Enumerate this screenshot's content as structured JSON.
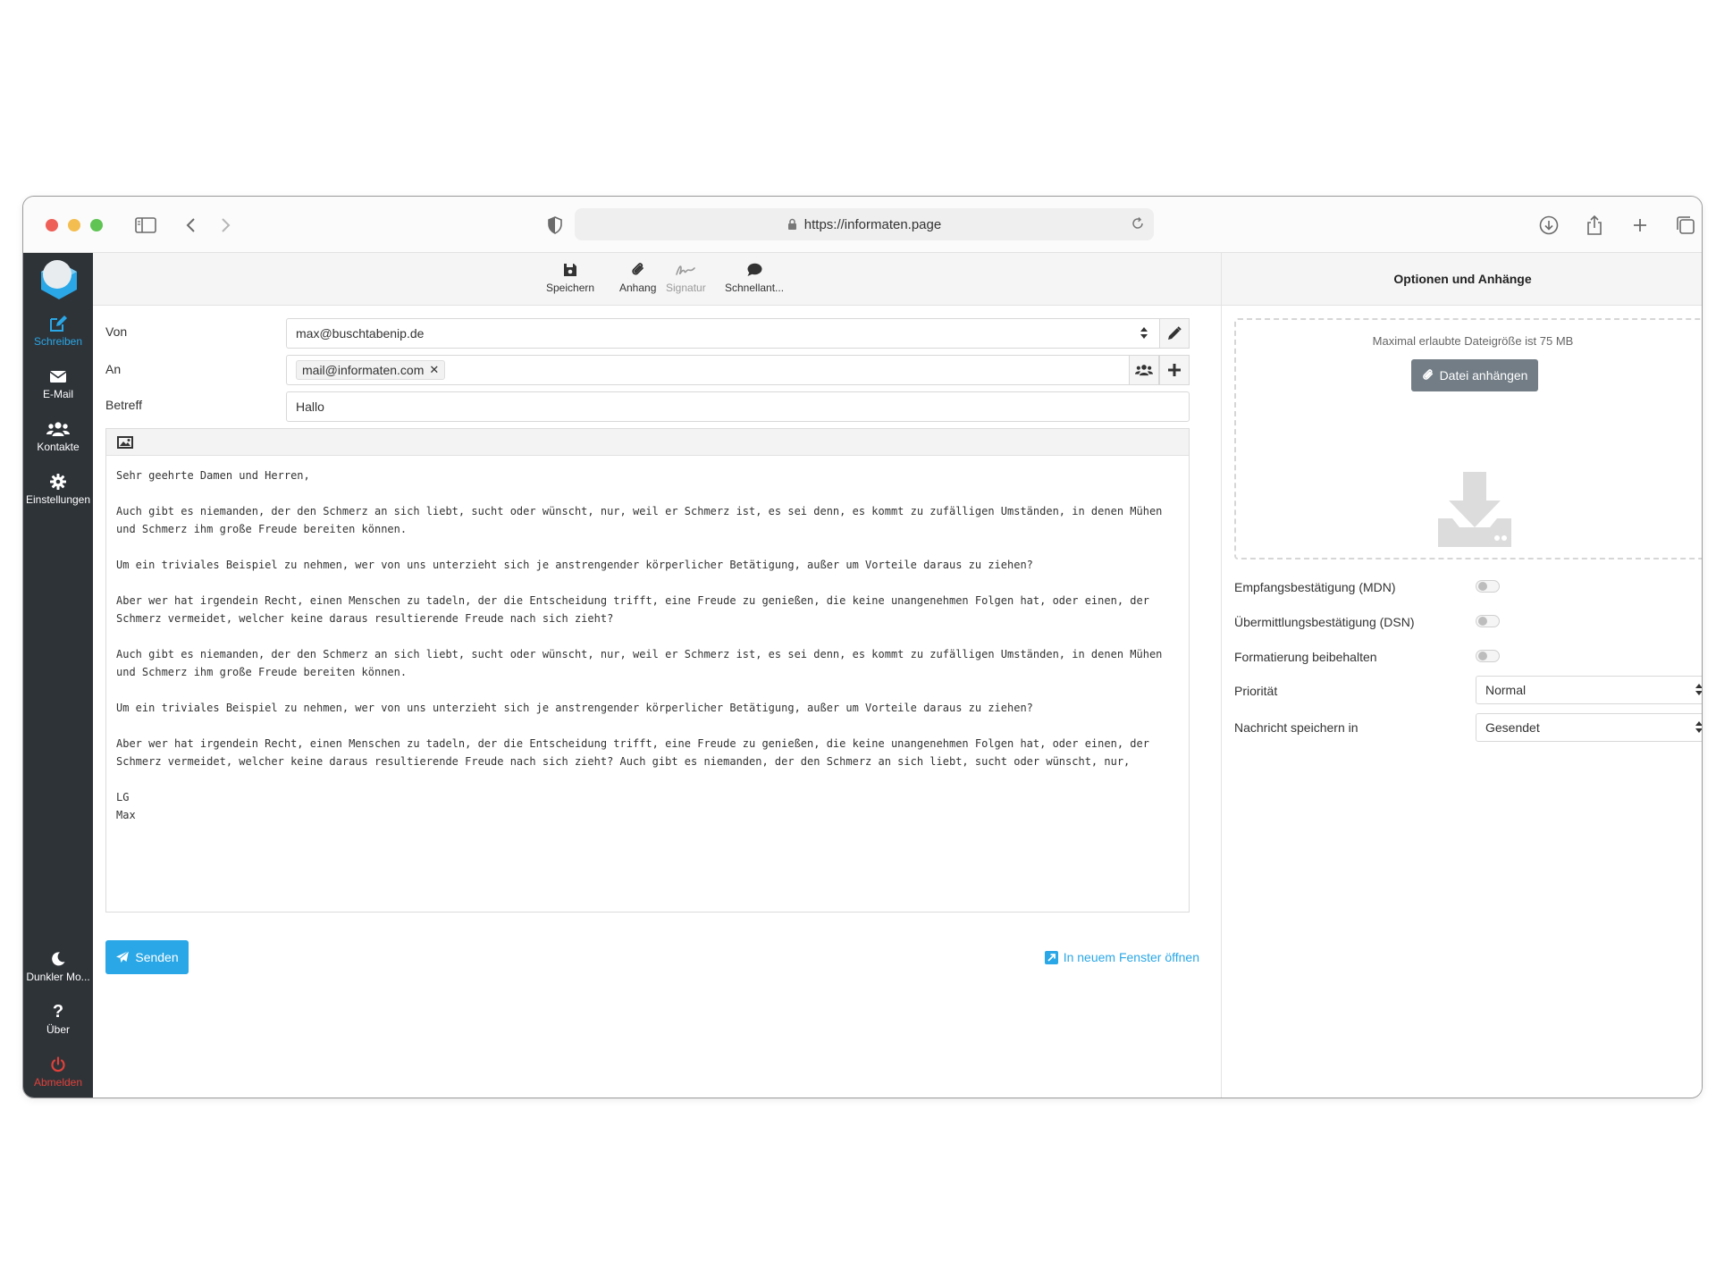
{
  "browser": {
    "url": "https://informaten.page"
  },
  "sidebar": {
    "items": [
      {
        "label": "Schreiben",
        "icon": "compose-icon"
      },
      {
        "label": "E-Mail",
        "icon": "envelope-icon"
      },
      {
        "label": "Kontakte",
        "icon": "users-icon"
      },
      {
        "label": "Einstellungen",
        "icon": "gear-icon"
      }
    ],
    "bottom": [
      {
        "label": "Dunkler Mo...",
        "icon": "moon-icon"
      },
      {
        "label": "Über",
        "icon": "question-icon"
      },
      {
        "label": "Abmelden",
        "icon": "power-icon"
      }
    ]
  },
  "toolbar": {
    "save": "Speichern",
    "attach": "Anhang",
    "signature": "Signatur",
    "quick_reply": "Schnellant..."
  },
  "compose": {
    "from_label": "Von",
    "from_value": "max@buschtabenip.de",
    "to_label": "An",
    "to_recipient": "mail@informaten.com",
    "subject_label": "Betreff",
    "subject_value": "Hallo",
    "body": [
      "Sehr geehrte Damen und Herren,",
      "Auch gibt es niemanden, der den Schmerz an sich liebt, sucht oder wünscht, nur, weil er Schmerz ist, es sei denn, es kommt zu zufälligen Umständen, in denen Mühen\nund Schmerz ihm große Freude bereiten können.",
      "Um ein triviales Beispiel zu nehmen, wer von uns unterzieht sich je anstrengender körperlicher Betätigung, außer um Vorteile daraus zu ziehen?",
      "Aber wer hat irgendein Recht, einen Menschen zu tadeln, der die Entscheidung trifft, eine Freude zu genießen, die keine unangenehmen Folgen hat, oder einen, der\nSchmerz vermeidet, welcher keine daraus resultierende Freude nach sich zieht?",
      "Auch gibt es niemanden, der den Schmerz an sich liebt, sucht oder wünscht, nur, weil er Schmerz ist, es sei denn, es kommt zu zufälligen Umständen, in denen Mühen\nund Schmerz ihm große Freude bereiten können.",
      "Um ein triviales Beispiel zu nehmen, wer von uns unterzieht sich je anstrengender körperlicher Betätigung, außer um Vorteile daraus zu ziehen?",
      "Aber wer hat irgendein Recht, einen Menschen zu tadeln, der die Entscheidung trifft, eine Freude zu genießen, die keine unangenehmen Folgen hat, oder einen, der\nSchmerz vermeidet, welcher keine daraus resultierende Freude nach sich zieht? Auch gibt es niemanden, der den Schmerz an sich liebt, sucht oder wünscht, nur,"
    ],
    "closing": "LG",
    "signature_name": "Max",
    "send_label": "Senden",
    "open_new_window": "In neuem Fenster öffnen"
  },
  "options": {
    "title": "Optionen und Anhänge",
    "max_size": "Maximal erlaubte Dateigröße ist 75 MB",
    "attach_button": "Datei anhängen",
    "mdn_label": "Empfangsbestätigung (MDN)",
    "dsn_label": "Übermittlungsbestätigung (DSN)",
    "keep_format_label": "Formatierung beibehalten",
    "priority_label": "Priorität",
    "priority_value": "Normal",
    "save_in_label": "Nachricht speichern in",
    "save_in_value": "Gesendet"
  },
  "colors": {
    "accent": "#2aa7e6",
    "sidebar_bg": "#2e3338",
    "danger": "#e0413a",
    "attach_button_bg": "#727d86"
  }
}
